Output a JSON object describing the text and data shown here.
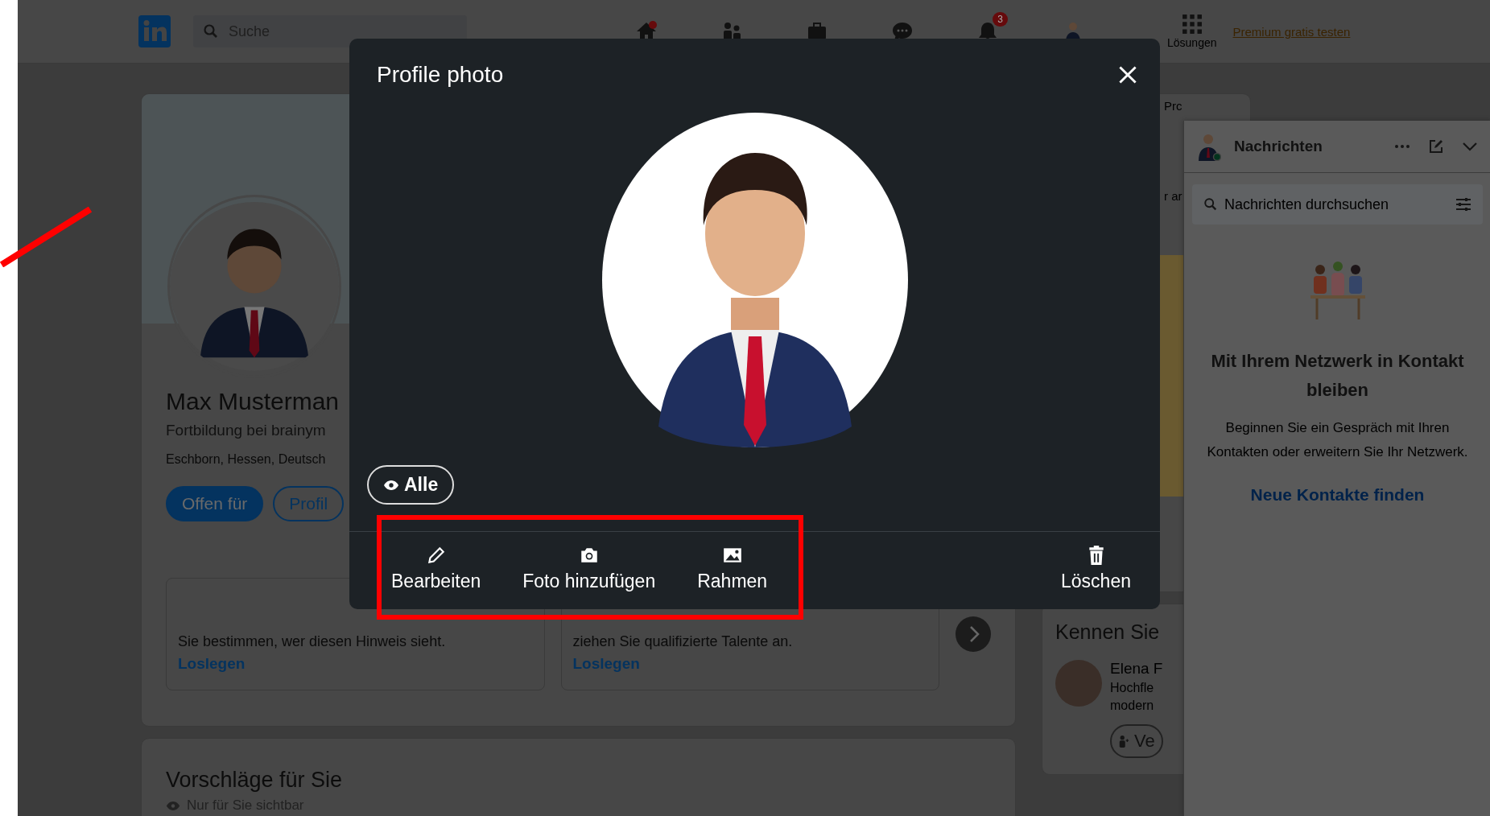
{
  "nav": {
    "search_placeholder": "Suche",
    "items": [
      {
        "kind": "home"
      },
      {
        "kind": "network"
      },
      {
        "kind": "jobs"
      },
      {
        "kind": "messages"
      },
      {
        "kind": "bell",
        "badge": "3"
      },
      {
        "kind": "me"
      }
    ],
    "solutions_label": "Lösungen",
    "premium_link": "Premium gratis testen"
  },
  "profile": {
    "name": "Max Musterman",
    "headline": "Fortbildung bei brainym",
    "location": "Eschborn, Hessen, Deutsch",
    "buttons": [
      {
        "label": "Offen für",
        "kind": "primary"
      },
      {
        "label": "Profil",
        "kind": "outline"
      }
    ],
    "cards": [
      {
        "text": "Sie bestimmen, wer diesen Hinweis sieht.",
        "link": "Loslegen"
      },
      {
        "text": "ziehen Sie qualifizierte Talente an.",
        "link": "Loslegen"
      }
    ]
  },
  "suggestions": {
    "title": "Vorschläge für Sie",
    "note": "Nur für Sie sichtbar"
  },
  "right_column": {
    "fragments": [
      "Prc",
      "r ar"
    ],
    "people_title": "Kennen Sie",
    "person": {
      "name": "Elena F",
      "lines": [
        "Hochfle",
        "modern"
      ],
      "button": "Ve"
    }
  },
  "messaging": {
    "title": "Nachrichten",
    "search_placeholder": "Nachrichten durchsuchen",
    "heading": "Mit Ihrem Netzwerk in Kontakt bleiben",
    "text": "Beginnen Sie ein Gespräch mit Ihren Kontakten oder erweitern Sie Ihr Netzwerk.",
    "link": "Neue Kontakte finden"
  },
  "modal": {
    "title": "Profile photo",
    "visibility": "Alle",
    "actions": [
      {
        "kind": "edit",
        "label": "Bearbeiten"
      },
      {
        "kind": "camera",
        "label": "Foto hinzufügen"
      },
      {
        "kind": "frame",
        "label": "Rahmen"
      },
      {
        "kind": "delete",
        "label": "Löschen"
      }
    ]
  }
}
